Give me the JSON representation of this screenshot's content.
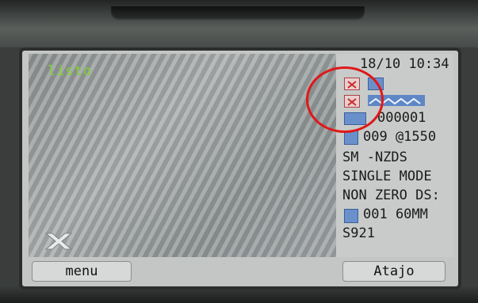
{
  "status": {
    "text": "listo"
  },
  "info": {
    "datetime": "18/10 10:34",
    "counter": "000001",
    "program": "009 @1550",
    "fiber_code": "SM  -NZDS",
    "fiber_mode": "SINGLE MODE",
    "fiber_ds": "NON ZERO DS:",
    "fiber_setting": "001 60MM",
    "model": "S921"
  },
  "softkeys": {
    "left": "menu",
    "right": "Atajo"
  },
  "icons": {
    "status_glyph": "x-glyph-icon",
    "fail_1": "fail-icon",
    "fail_2": "fail-icon",
    "ok_1": "blue-icon",
    "signal": "signal-wave-icon",
    "counter_icon": "counter-icon",
    "program_icon": "program-icon",
    "fiber_icon": "fiber-icon"
  },
  "colors": {
    "status_text": "#7fd52b",
    "annotation": "#e01818",
    "icon_blue": "#5f87c6"
  }
}
